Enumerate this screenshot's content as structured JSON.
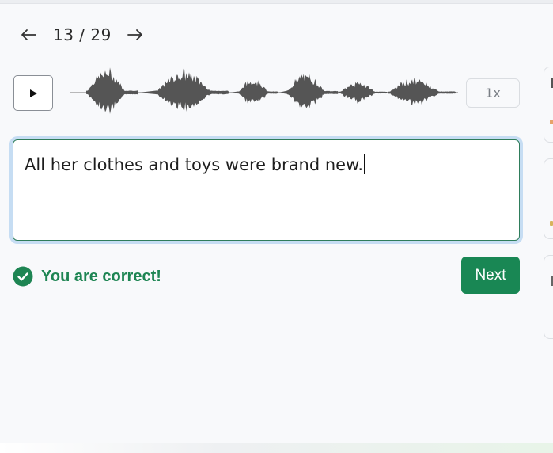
{
  "pager": {
    "prev_icon": "arrow-left-icon",
    "next_icon": "arrow-right-icon",
    "current": "13",
    "total": "29",
    "label": "13 / 29"
  },
  "player": {
    "play_icon": "play-icon",
    "speed_label": "1x"
  },
  "answer": {
    "text": "All her clothes and toys were brand new."
  },
  "feedback": {
    "icon": "check-circle-icon",
    "message": "You are correct!",
    "color": "#1e8553"
  },
  "actions": {
    "next_label": "Next",
    "next_color": "#198754"
  },
  "colors": {
    "focus_ring": "#c6ddf3",
    "input_border": "#2f7d5b",
    "waveform": "#555555"
  }
}
